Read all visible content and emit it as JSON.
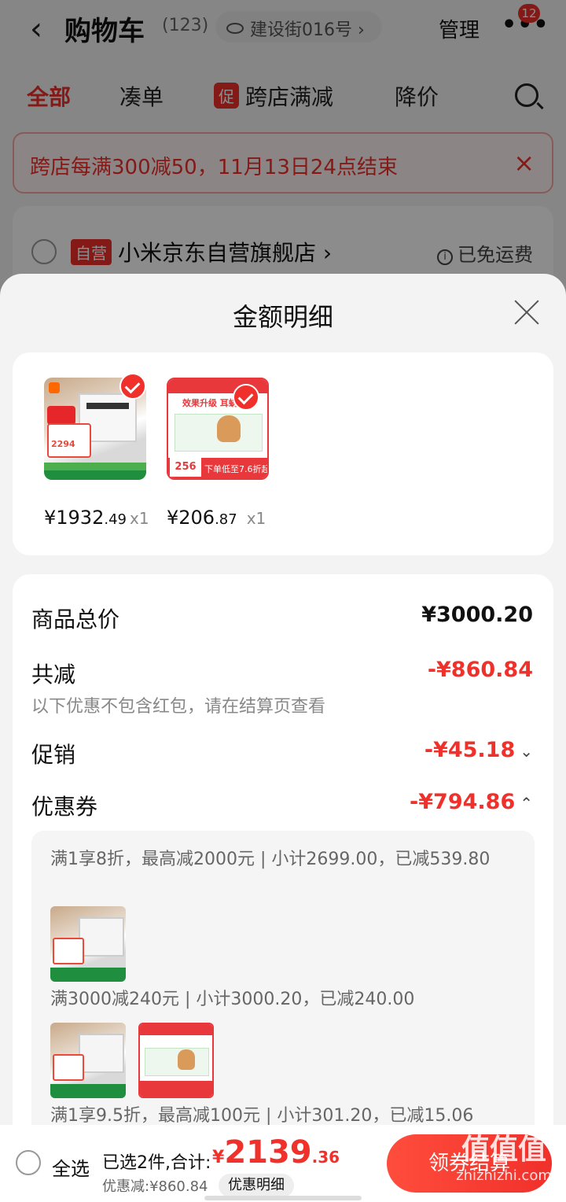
{
  "header": {
    "title": "购物车",
    "count": "(123)",
    "address": "建设街016号",
    "address_chevron": "›",
    "manage": "管理",
    "more_icon": "•••",
    "badge": "12"
  },
  "filters": {
    "all": "全部",
    "bundle": "凑单",
    "promo_tag": "促",
    "cross_store": "跨店满减",
    "price_drop": "降价"
  },
  "notice": {
    "text": "跨店每满300减50，11月13日24点结束",
    "close": "×"
  },
  "store": {
    "self_tag": "自营",
    "name": "小米京东自营旗舰店 ›",
    "free_shipping": "已免运费",
    "info_icon": "i"
  },
  "sheet": {
    "title": "金额明细",
    "products": [
      {
        "price_int": "¥1932",
        "price_dec": ".49",
        "qty": "x1",
        "thumb_price": "2294"
      },
      {
        "price_int": "¥206",
        "price_dec": ".87",
        "qty": "x1",
        "thumb_headline": "效果升级 耳蜗更佳",
        "thumb_num": "256",
        "thumb_bottom": "下单低至7.6折起"
      }
    ],
    "total_label": "商品总价",
    "total_value": "¥3000.20",
    "reduce_label": "共减",
    "reduce_value": "-¥860.84",
    "reduce_note": "以下优惠不包含红包，请在结算页查看",
    "promo_label": "促销",
    "promo_value": "-¥45.18",
    "coupon_label": "优惠券",
    "coupon_value": "-¥794.86",
    "chevron_down": "⌄",
    "chevron_up": "⌃",
    "coupons": [
      {
        "text": "满1享8折，最高减2000元 | 小计2699.00，已减539.80"
      },
      {
        "text": "满3000减240元 | 小计3000.20，已减240.00"
      },
      {
        "text": "满1享9.5折，最高减100元 | 小计301.20，已减15.06"
      }
    ]
  },
  "bottom": {
    "select_all": "全选",
    "selected": "已选2件,合计:",
    "currency": "¥",
    "total_int": "2139",
    "total_dec": ".36",
    "discount": "优惠减:¥860.84",
    "detail_chip": "优惠明细",
    "checkout": "领券结算",
    "watermark": "值值值",
    "watermark_url": "zhizhizhi.com"
  },
  "colors": {
    "accent": "#f0302b",
    "overlay": "rgba(0,0,0,0.45)"
  }
}
